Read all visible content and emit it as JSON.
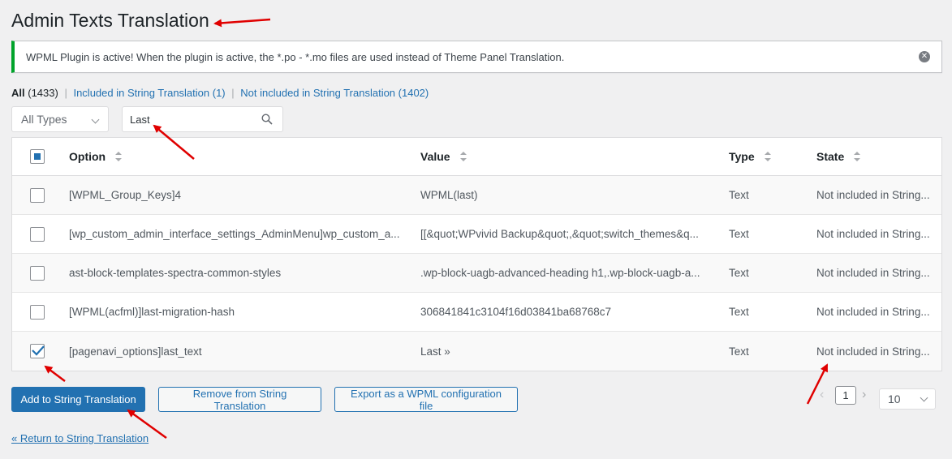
{
  "page": {
    "title": "Admin Texts Translation"
  },
  "notice": {
    "text": "WPML Plugin is active! When the plugin is active, the *.po - *.mo files are used instead of Theme Panel Translation.",
    "dismiss_icon": "close-circle-icon",
    "accent_color": "#00a32a"
  },
  "views": {
    "all": "All",
    "all_count": "(1433)",
    "included": "Included in String Translation (1)",
    "not_included": "Not included in String Translation (1402)",
    "separator": "|"
  },
  "filters": {
    "type_select_value": "All Types",
    "search_value": "Last",
    "search_icon": "search-icon"
  },
  "table": {
    "columns": {
      "option": "Option",
      "value": "Value",
      "type": "Type",
      "state": "State"
    },
    "rows": [
      {
        "option": "[WPML_Group_Keys]4",
        "value": "WPML(last)",
        "type": "Text",
        "state": "Not included in String...",
        "checked": false
      },
      {
        "option": "[wp_custom_admin_interface_settings_AdminMenu]wp_custom_a...",
        "value": "[[&quot;WPvivid Backup&quot;,&quot;switch_themes&q...",
        "type": "Text",
        "state": "Not included in String...",
        "checked": false
      },
      {
        "option": "ast-block-templates-spectra-common-styles",
        "value": ".wp-block-uagb-advanced-heading h1,.wp-block-uagb-a...",
        "type": "Text",
        "state": "Not included in String...",
        "checked": false
      },
      {
        "option": "[WPML(acfml)]last-migration-hash",
        "value": "306841841c3104f16d03841ba68768c7",
        "type": "Text",
        "state": "Not included in String...",
        "checked": false
      },
      {
        "option": "[pagenavi_options]last_text",
        "value": "Last »",
        "type": "Text",
        "state": "Not included in String...",
        "checked": true
      }
    ]
  },
  "actions": {
    "add": "Add to String Translation",
    "remove": "Remove from String Translation",
    "export": "Export as a WPML configuration file"
  },
  "pagination": {
    "current_page": "1",
    "prev_symbol": "‹",
    "next_symbol": "›",
    "per_page": "10"
  },
  "return_link": "« Return to String Translation",
  "colors": {
    "primary": "#2271b1",
    "annotation_arrow": "#e00000"
  }
}
